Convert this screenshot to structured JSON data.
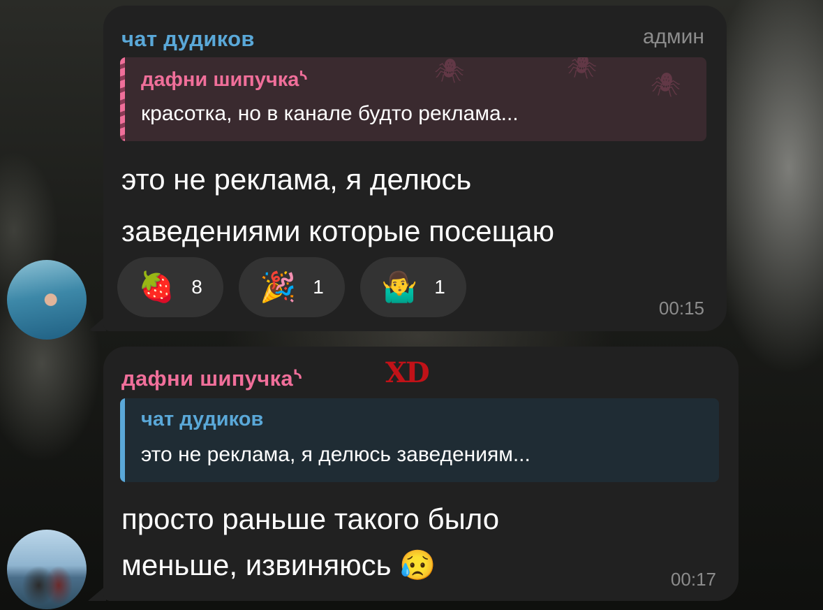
{
  "messages": [
    {
      "sender": "чат дудиков",
      "badge": "админ",
      "reply": {
        "name": "дафни шипучка",
        "name_suffix": "ᔅ",
        "text": "красотка, но в канале будто реклама..."
      },
      "text_line1": "это не реклама, я делюсь",
      "text_line2": "заведениями которые посещаю",
      "reactions": [
        {
          "emoji": "🍓",
          "count": "8"
        },
        {
          "emoji": "🎉",
          "count": "1"
        },
        {
          "emoji": "🤷‍♂️",
          "count": "1"
        }
      ],
      "time": "00:15"
    },
    {
      "sender": "дафни шипучка",
      "sender_suffix": "ᔅ",
      "sender_emoji": "XD",
      "reply": {
        "name": "чат дудиков",
        "text": "это не реклама, я делюсь заведениям..."
      },
      "text_line1": "просто раньше такого было",
      "text_line2": "меньше, извиняюсь 😥",
      "time": "00:17"
    }
  ],
  "colors": {
    "bubble": "#212121",
    "sender_blue": "#5aa8d8",
    "sender_pink": "#f06f9a",
    "meta_gray": "#8c8c8c"
  }
}
